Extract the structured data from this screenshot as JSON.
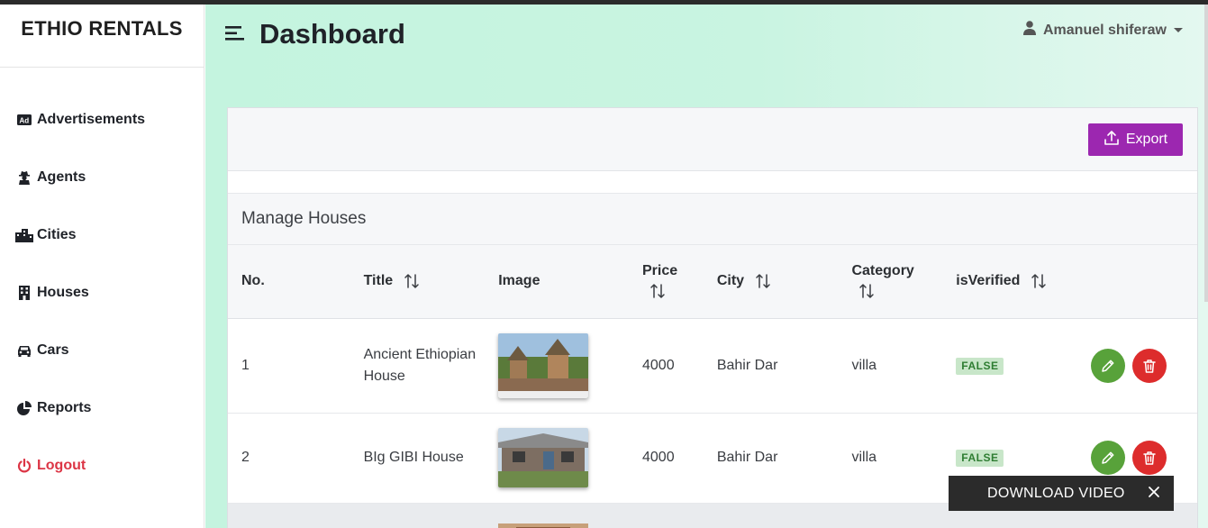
{
  "brand": "ETHIO RENTALS",
  "nav": [
    {
      "label": "Advertisements",
      "icon": "ad-icon"
    },
    {
      "label": "Agents",
      "icon": "user-secret-icon"
    },
    {
      "label": "Cities",
      "icon": "city-icon"
    },
    {
      "label": "Houses",
      "icon": "building-icon"
    },
    {
      "label": "Cars",
      "icon": "car-icon"
    },
    {
      "label": "Reports",
      "icon": "pie-chart-icon"
    },
    {
      "label": "Logout",
      "icon": "power-icon"
    }
  ],
  "header": {
    "title": "Dashboard",
    "user": "Amanuel shiferaw"
  },
  "toolbar": {
    "export_label": "Export"
  },
  "section": {
    "title": "Manage Houses"
  },
  "table": {
    "columns": {
      "no": "No.",
      "title": "Title",
      "image": "Image",
      "price": "Price",
      "city": "City",
      "category": "Category",
      "verified": "isVerified"
    },
    "rows": [
      {
        "no": "1",
        "title": "Ancient Ethiopian House",
        "price": "4000",
        "city": "Bahir Dar",
        "category": "villa",
        "verified": "FALSE"
      },
      {
        "no": "2",
        "title": "BIg GIBI House",
        "price": "4000",
        "city": "Bahir Dar",
        "category": "villa",
        "verified": "FALSE"
      }
    ]
  },
  "overlay": {
    "download_label": "DOWNLOAD VIDEO"
  },
  "colors": {
    "accent": "#9c27b0",
    "edit": "#58a23a",
    "delete": "#dd2c2c",
    "logout": "#dc3545",
    "badge_bg": "#c8e6c9",
    "badge_text": "#2e7d32"
  }
}
